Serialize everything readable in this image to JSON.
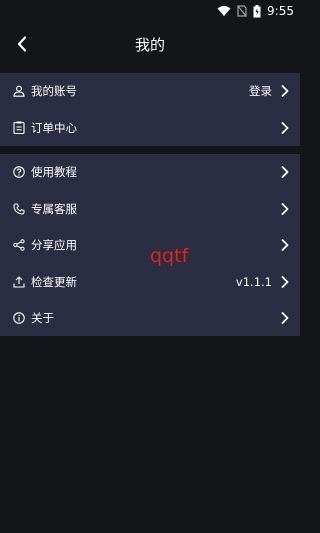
{
  "status_bar": {
    "time": "9:55"
  },
  "header": {
    "title": "我的"
  },
  "group1": [
    {
      "label": "我的账号",
      "right": "登录",
      "icon": "user-icon"
    },
    {
      "label": "订单中心",
      "right": "",
      "icon": "clipboard-icon"
    }
  ],
  "group2": [
    {
      "label": "使用教程",
      "right": "",
      "icon": "help-circle-icon"
    },
    {
      "label": "专属客服",
      "right": "",
      "icon": "phone-icon"
    },
    {
      "label": "分享应用",
      "right": "",
      "icon": "share-icon"
    },
    {
      "label": "检查更新",
      "right": "v1.1.1",
      "icon": "upload-icon"
    },
    {
      "label": "关于",
      "right": "",
      "icon": "info-icon"
    }
  ],
  "watermark": "qqtf",
  "colors": {
    "background": "#141519",
    "group": "#2b2d42",
    "watermark": "#e0231e"
  }
}
